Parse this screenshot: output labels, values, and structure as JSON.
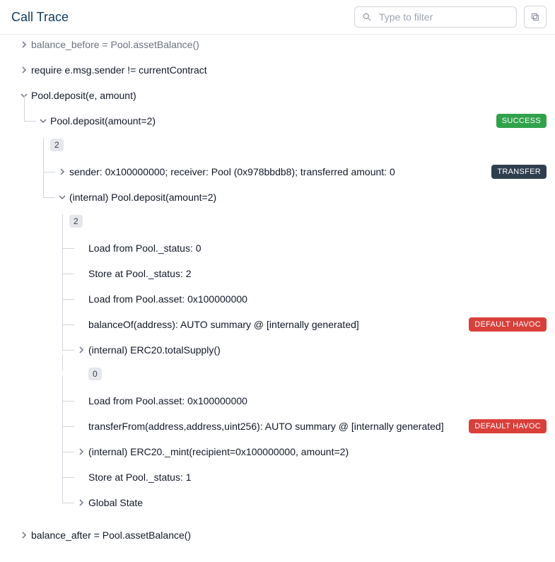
{
  "header": {
    "title": "Call Trace",
    "filter_placeholder": "Type to filter"
  },
  "badges": {
    "success": "SUCCESS",
    "transfer": "TRANSFER",
    "havoc": "DEFAULT HAVOC"
  },
  "rows": {
    "r0": "balance_before = Pool.assetBalance()",
    "r1": "require e.msg.sender != currentContract",
    "r2": "Pool.deposit(e, amount)",
    "r3": "Pool.deposit(amount=2)",
    "r3_count": "2",
    "r4": "sender: 0x100000000; receiver: Pool (0x978bbdb8); transferred amount: 0",
    "r5": "(internal) Pool.deposit(amount=2)",
    "r5_count": "2",
    "r6": "Load from Pool._status: 0",
    "r7": "Store at Pool._status: 2",
    "r8": "Load from Pool.asset: 0x100000000",
    "r9": "balanceOf(address): AUTO summary @ [internally generated]",
    "r10": "(internal) ERC20.totalSupply()",
    "r10_count": "0",
    "r11": "Load from Pool.asset: 0x100000000",
    "r12": "transferFrom(address,address,uint256): AUTO summary @ [internally generated]",
    "r13": "(internal) ERC20._mint(recipient=0x100000000, amount=2)",
    "r14": "Store at Pool._status: 1",
    "r15": "Global State",
    "r16": "balance_after = Pool.assetBalance()"
  }
}
